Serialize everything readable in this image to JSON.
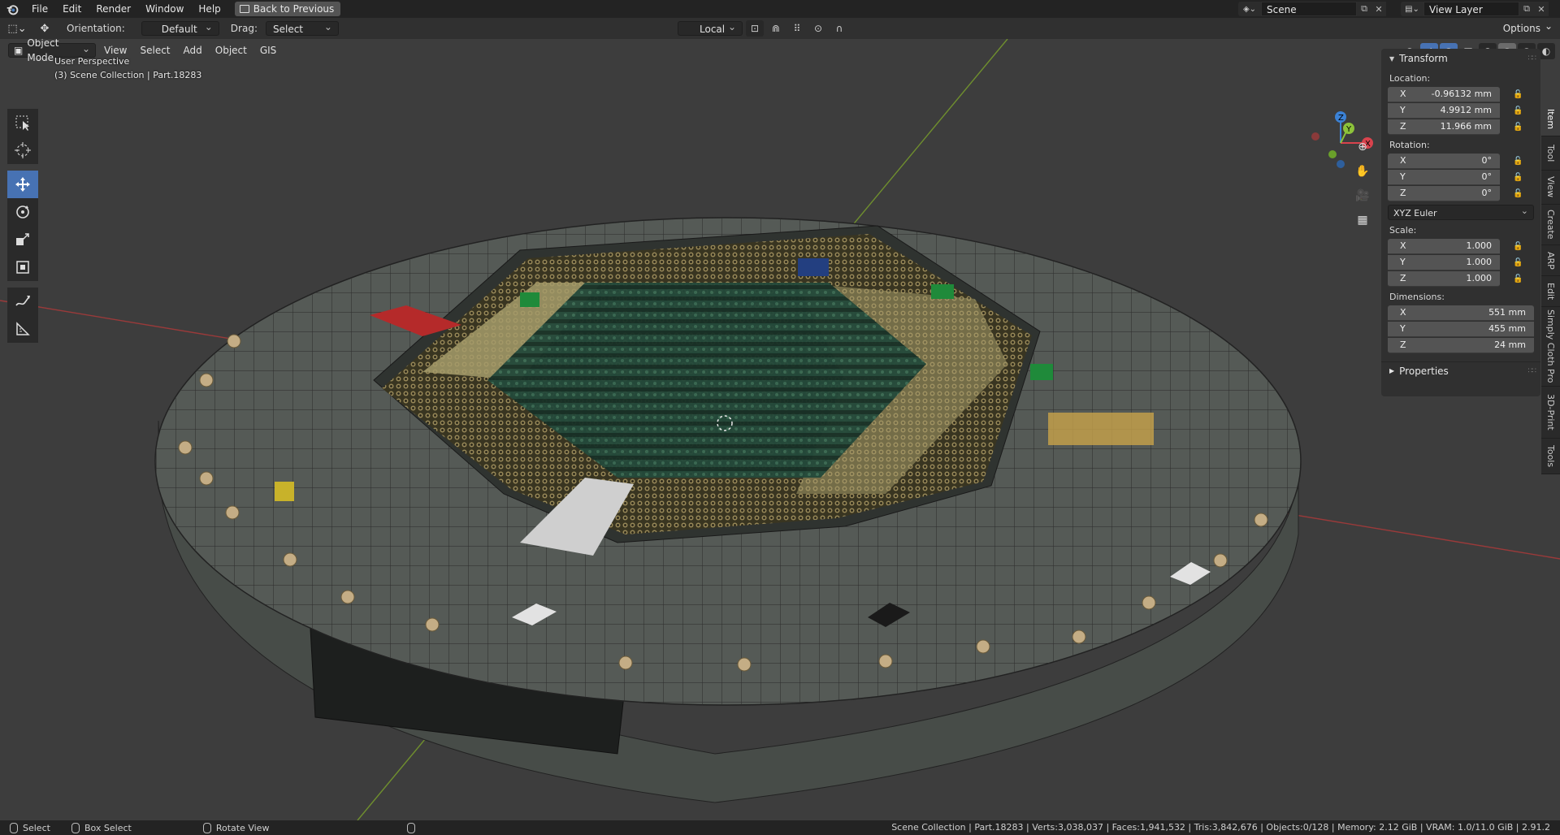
{
  "menu": {
    "items": [
      "File",
      "Edit",
      "Render",
      "Window",
      "Help"
    ],
    "back_label": "Back to Previous"
  },
  "scene": {
    "name": "Scene",
    "view_layer": "View Layer"
  },
  "header": {
    "orientation_label": "Orientation:",
    "orientation_value": "Default",
    "drag_label": "Drag:",
    "drag_value": "Select Box",
    "pivot_value": "Local",
    "options_label": "Options"
  },
  "viewport": {
    "mode": "Object Mode",
    "menus": [
      "View",
      "Select",
      "Add",
      "Object",
      "GIS"
    ],
    "perspective": "User Perspective",
    "collection": "(3) Scene Collection | Part.18283"
  },
  "transform_panel": {
    "title": "Transform",
    "location_label": "Location:",
    "location": [
      {
        "axis": "X",
        "value": "-0.96132 mm"
      },
      {
        "axis": "Y",
        "value": "4.9912 mm"
      },
      {
        "axis": "Z",
        "value": "11.966 mm"
      }
    ],
    "rotation_label": "Rotation:",
    "rotation": [
      {
        "axis": "X",
        "value": "0°"
      },
      {
        "axis": "Y",
        "value": "0°"
      },
      {
        "axis": "Z",
        "value": "0°"
      }
    ],
    "rotation_mode": "XYZ Euler",
    "scale_label": "Scale:",
    "scale": [
      {
        "axis": "X",
        "value": "1.000"
      },
      {
        "axis": "Y",
        "value": "1.000"
      },
      {
        "axis": "Z",
        "value": "1.000"
      }
    ],
    "dimensions_label": "Dimensions:",
    "dimensions": [
      {
        "axis": "X",
        "value": "551 mm"
      },
      {
        "axis": "Y",
        "value": "455 mm"
      },
      {
        "axis": "Z",
        "value": "24 mm"
      }
    ],
    "properties_label": "Properties"
  },
  "side_tabs": [
    "Item",
    "Tool",
    "View",
    "Create",
    "ARP",
    "Edit",
    "Simply Cloth Pro",
    "3D-Print",
    "Tools"
  ],
  "gizmo": {
    "z": "Z",
    "y": "Y",
    "x": "X"
  },
  "status": {
    "select": "Select",
    "box_select": "Box Select",
    "rotate_view": "Rotate View",
    "stats": "Scene Collection | Part.18283 | Verts:3,038,037 | Faces:1,941,532 | Tris:3,842,676 | Objects:0/128 | Memory: 2.12 GiB | VRAM: 1.0/11.0 GiB | 2.91.2"
  },
  "colors": {
    "accent": "#4772b3",
    "axis_x": "#d9434d",
    "axis_y": "#8cc23a",
    "axis_z": "#3b82d6"
  }
}
